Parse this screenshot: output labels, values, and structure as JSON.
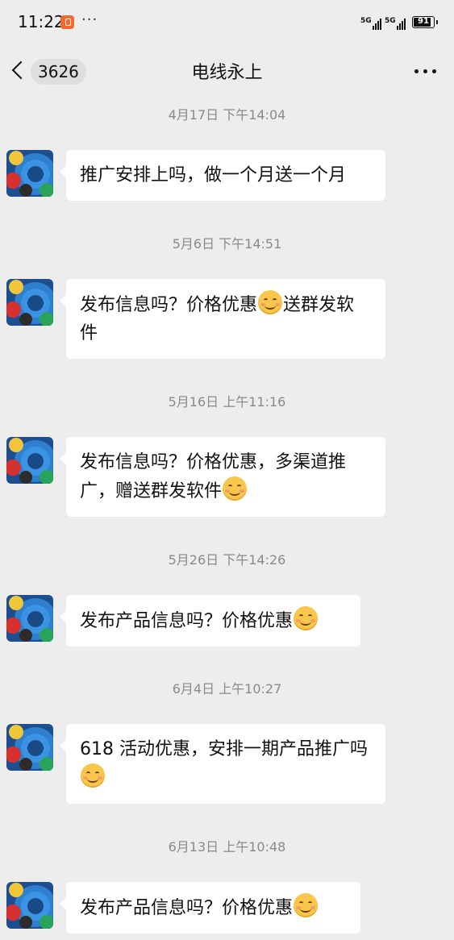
{
  "status": {
    "time": "11:22",
    "more": "···",
    "signal1": "5G",
    "signal2": "5G",
    "battery": "91"
  },
  "nav": {
    "unread": "3626",
    "title": "电线永上"
  },
  "messages": [
    {
      "time": "4月17日 下午14:04",
      "parts": [
        {
          "t": "推广安排上吗，做一个月送一个月"
        }
      ]
    },
    {
      "time": "5月6日 下午14:51",
      "parts": [
        {
          "t": "发布信息吗？价格优惠"
        },
        {
          "emoji": "smile-emoji"
        },
        {
          "t": "送群发软件"
        }
      ]
    },
    {
      "time": "5月16日 上午11:16",
      "parts": [
        {
          "t": "发布信息吗？价格优惠，多渠道推广，赠送群发软件"
        },
        {
          "emoji": "smile-emoji"
        }
      ]
    },
    {
      "time": "5月26日 下午14:26",
      "parts": [
        {
          "t": "发布产品信息吗？价格优惠"
        },
        {
          "emoji": "smile-emoji"
        }
      ]
    },
    {
      "time": "6月4日 上午10:27",
      "parts": [
        {
          "t": "618 活动优惠，安排一期产品推广吗"
        },
        {
          "emoji": "smile-emoji"
        }
      ]
    },
    {
      "time": "6月13日 上午10:48",
      "parts": [
        {
          "t": "发布产品信息吗？价格优惠"
        },
        {
          "emoji": "smile-emoji"
        }
      ]
    }
  ]
}
